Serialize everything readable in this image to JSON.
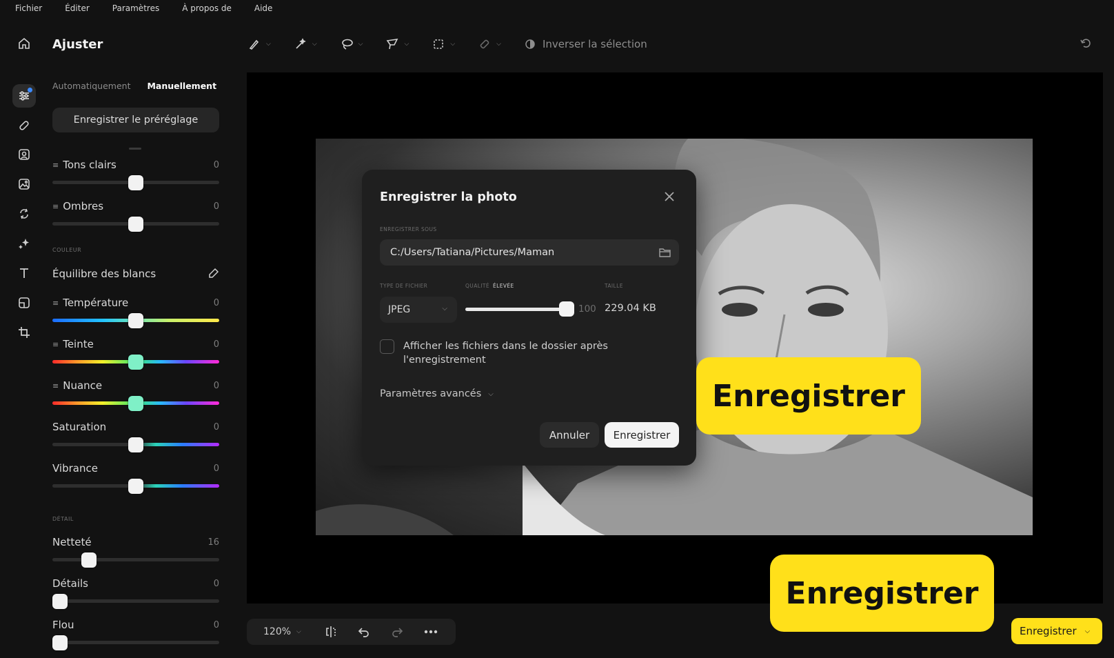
{
  "menu": [
    "Fichier",
    "Éditer",
    "Paramètres",
    "À propos de",
    "Aide"
  ],
  "panel": {
    "title": "Ajuster",
    "tabs": {
      "auto": "Automatiquement",
      "manual": "Manuellement"
    },
    "preset_button": "Enregistrer le préréglage",
    "sliders_top": [
      {
        "label": "Tons clairs",
        "value": "0",
        "position": 0.5
      },
      {
        "label": "Ombres",
        "value": "0",
        "position": 0.5
      }
    ],
    "color_section": "COULEUR",
    "white_balance": "Équilibre des blancs",
    "sliders_color": [
      {
        "label": "Température",
        "value": "0",
        "position": 0.5
      },
      {
        "label": "Teinte",
        "value": "0",
        "position": 0.5
      },
      {
        "label": "Nuance",
        "value": "0",
        "position": 0.5
      },
      {
        "label": "Saturation",
        "value": "0",
        "position": 0.5
      },
      {
        "label": "Vibrance",
        "value": "0",
        "position": 0.5
      }
    ],
    "detail_section": "DÉTAIL",
    "sliders_detail": [
      {
        "label": "Netteté",
        "value": "16",
        "position": 0.19
      },
      {
        "label": "Détails",
        "value": "0",
        "position": 0
      },
      {
        "label": "Flou",
        "value": "0",
        "position": 0
      }
    ]
  },
  "toolbar": {
    "invert_selection": "Inverser la sélection"
  },
  "dialog": {
    "title": "Enregistrer la photo",
    "save_as_label": "ENREGISTRER SOUS",
    "path": "C:/Users/Tatiana/Pictures/Maman",
    "file_type_label": "TYPE DE FICHIER",
    "file_type": "JPEG",
    "quality_label": "QUALITÉ",
    "quality_level": "ÉLEVÉE",
    "quality_value": "100",
    "quality_fraction": 1.0,
    "size_label": "TAILLE",
    "size_value": "229.04 KB",
    "show_files_checkbox": "Afficher les fichiers dans le dossier après l'enregistrement",
    "advanced": "Paramètres avancés",
    "cancel": "Annuler",
    "save": "Enregistrer"
  },
  "callouts": {
    "first": "Enregistrer",
    "second": "Enregistrer"
  },
  "bottom": {
    "zoom": "120%",
    "save_button": "Enregistrer"
  },
  "colors": {
    "accent_yellow": "#ffe01a",
    "badge_blue": "#3d8bff",
    "panel_bg": "#121212"
  }
}
